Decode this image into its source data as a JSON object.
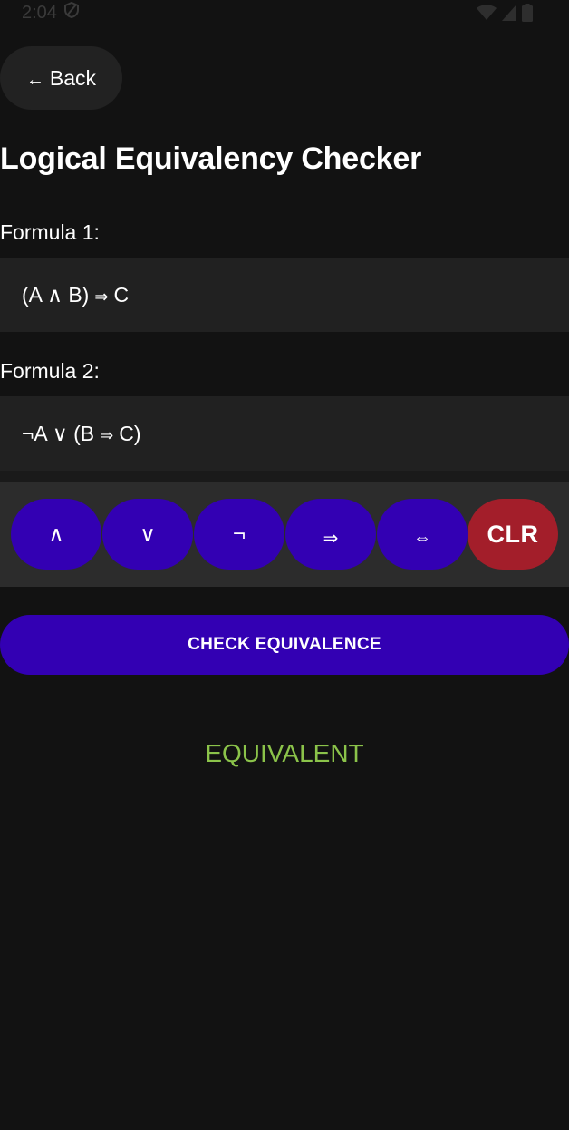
{
  "status_bar": {
    "time": "2:04",
    "icons": [
      "shield-icon",
      "wifi-icon",
      "signal-icon",
      "battery-icon"
    ]
  },
  "header": {
    "back_arrow": "←",
    "back_label": "Back",
    "title": "Logical Equivalency Checker"
  },
  "formula1": {
    "label": "Formula 1:",
    "part_a": "(A ∧ B)",
    "arrow": "⇒",
    "part_b": "C"
  },
  "formula2": {
    "label": "Formula 2:",
    "part_a": "¬A ∨ (B",
    "arrow": "⇒",
    "part_b": "C)"
  },
  "keypad": {
    "keys": [
      {
        "label": "∧",
        "name": "and-key"
      },
      {
        "label": "∨",
        "name": "or-key"
      },
      {
        "label": "¬",
        "name": "not-key"
      },
      {
        "label": "⇒",
        "name": "implies-key"
      },
      {
        "label": "⇔",
        "name": "iff-key"
      },
      {
        "label": "CLR",
        "name": "clear-key"
      }
    ]
  },
  "actions": {
    "check_label": "CHECK EQUIVALENCE"
  },
  "result": {
    "text": "EQUIVALENT",
    "color": "#8bc34a"
  },
  "colors": {
    "background": "#121212",
    "accent": "#3300b3",
    "clear": "#a31e2a",
    "field": "#212121"
  }
}
